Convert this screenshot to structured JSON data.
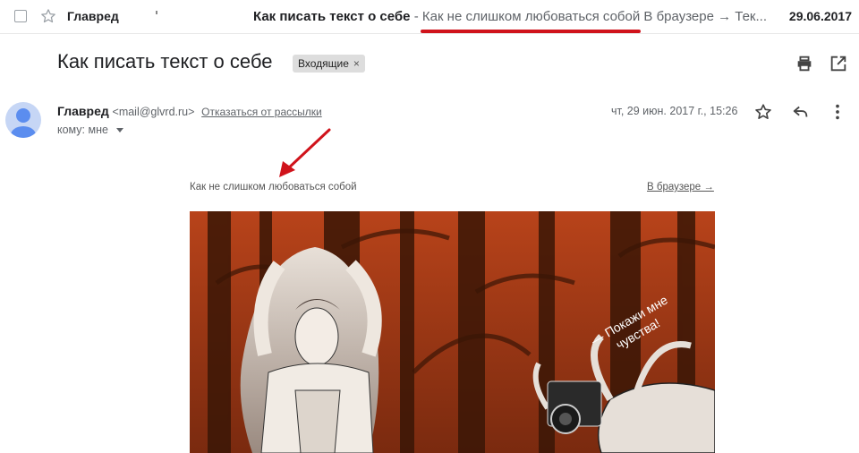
{
  "inbox_row": {
    "sender": "Главред",
    "subject": "Как писать текст о себе",
    "separator": " - ",
    "snippet": "Как не слишком любоваться собой В браузере → Тек...",
    "date": "29.06.2017"
  },
  "thread": {
    "title": "Как писать текст о себе",
    "label": "Входящие",
    "label_remove": "×"
  },
  "message": {
    "sender_name": "Главред",
    "sender_email": "<mail@glvrd.ru>",
    "unsubscribe": "Отказаться от рассылки",
    "to": "кому: мне",
    "date": "чт, 29 июн. 2017 г., 15:26"
  },
  "email_body": {
    "preheader": "Как не слишком любоваться собой",
    "browser_link": "В браузере →",
    "hero_caption_line1": "— Покажи мне",
    "hero_caption_line2": "чувства!"
  },
  "icons": {
    "select": "checkbox",
    "star": "star-icon",
    "print": "print-icon",
    "open_new_window": "open-in-new-icon",
    "reply": "reply-icon",
    "more": "more-vert-icon"
  },
  "colors": {
    "annotation_red": "#d0131b",
    "hero_orange": "#b8431a",
    "avatar_bg": "#c6d6f5",
    "avatar_fg": "#5b8def"
  }
}
